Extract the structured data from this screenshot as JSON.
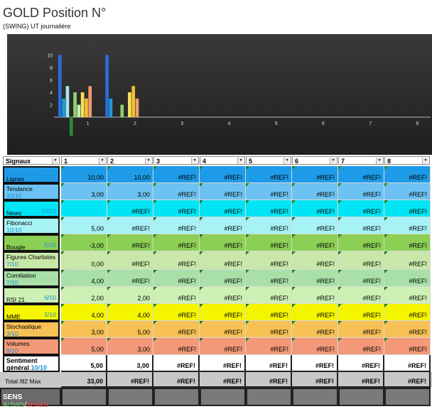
{
  "title": "GOLD Position N°",
  "subtitle": "(SWING) UT journalière",
  "chart_data": {
    "type": "bar",
    "categories": [
      "1",
      "2",
      "3",
      "4",
      "5",
      "6",
      "7",
      "8"
    ],
    "yticks": [
      "10",
      "8",
      "6",
      "4",
      "2"
    ],
    "ylim": [
      -3,
      12
    ],
    "series": [
      {
        "color": "#2a6fd8",
        "values": [
          10,
          10,
          null,
          null,
          null,
          null,
          null,
          null
        ]
      },
      {
        "color": "#1e9bd7",
        "values": [
          3,
          3,
          null,
          null,
          null,
          null,
          null,
          null
        ]
      },
      {
        "color": "#a8e6f0",
        "values": [
          5,
          null,
          null,
          null,
          null,
          null,
          null,
          null
        ]
      },
      {
        "color": "#2e8b2e",
        "values": [
          -3,
          null,
          null,
          null,
          null,
          null,
          null,
          null
        ]
      },
      {
        "color": "#8fd16a",
        "values": [
          4,
          2,
          null,
          null,
          null,
          null,
          null,
          null
        ]
      },
      {
        "color": "#c9ecb8",
        "values": [
          2,
          null,
          null,
          null,
          null,
          null,
          null,
          null
        ]
      },
      {
        "color": "#f7e25a",
        "values": [
          4,
          4,
          null,
          null,
          null,
          null,
          null,
          null
        ]
      },
      {
        "color": "#f5c030",
        "values": [
          3,
          5,
          null,
          null,
          null,
          null,
          null,
          null
        ]
      },
      {
        "color": "#f39a70",
        "values": [
          5,
          3,
          null,
          null,
          null,
          null,
          null,
          null
        ]
      }
    ]
  },
  "header": {
    "signals": "Signaux",
    "cols": [
      "1",
      "2",
      "3",
      "4",
      "5",
      "6",
      "7",
      "8"
    ]
  },
  "rows": [
    {
      "name": "Lignes",
      "score": "10/10",
      "score_pos": "right",
      "bg": "#1e9be8",
      "values": [
        "10,00",
        "10,00",
        "#REF!",
        "#REF!",
        "#REF!",
        "#REF!",
        "#REF!",
        "#REF!"
      ]
    },
    {
      "name": "Tendance",
      "score": "10/10",
      "score_pos": "below",
      "bg": "#6cc2f2",
      "values": [
        "3,00",
        "3,00",
        "#REF!",
        "#REF!",
        "#REF!",
        "#REF!",
        "#REF!",
        "#REF!"
      ]
    },
    {
      "name": "News",
      "score": "10/10",
      "score_pos": "right",
      "bg": "#00e5f5",
      "values": [
        "",
        "#REF!",
        "#REF!",
        "#REF!",
        "#REF!",
        "#REF!",
        "#REF!",
        "#REF!"
      ]
    },
    {
      "name": "Fibonacci",
      "score": "10/10",
      "score_pos": "below",
      "bg": "#a6f2f5",
      "values": [
        "5,00",
        "#REF!",
        "#REF!",
        "#REF!",
        "#REF!",
        "#REF!",
        "#REF!",
        "#REF!"
      ]
    },
    {
      "name": "Bougie",
      "score": "5/10",
      "score_pos": "right",
      "bg": "#8ccf55",
      "values": [
        "-3,00",
        "#REF!",
        "#REF!",
        "#REF!",
        "#REF!",
        "#REF!",
        "#REF!",
        "#REF!"
      ]
    },
    {
      "name": "Figures Chartistes",
      "score": "7/10",
      "score_pos": "below",
      "bg": "#c8e7a8",
      "values": [
        "0,00",
        "#REF!",
        "#REF!",
        "#REF!",
        "#REF!",
        "#REF!",
        "#REF!",
        "#REF!"
      ]
    },
    {
      "name": "Corrélation",
      "score": "7/10",
      "score_pos": "below",
      "bg": "#a8e0a8",
      "values": [
        "4,00",
        "#REF!",
        "#REF!",
        "#REF!",
        "#REF!",
        "#REF!",
        "#REF!",
        "#REF!"
      ]
    },
    {
      "name": "RSI 21",
      "score": "6/10",
      "score_pos": "right",
      "bg": "#cdf0b4",
      "values": [
        "2,00",
        "2,00",
        "#REF!",
        "#REF!",
        "#REF!",
        "#REF!",
        "#REF!",
        "#REF!"
      ]
    },
    {
      "name": "MME",
      "score": "5/10",
      "score_pos": "right",
      "bg": "#f5f500",
      "values": [
        "4,00",
        "4,00",
        "#REF!",
        "#REF!",
        "#REF!",
        "#REF!",
        "#REF!",
        "#REF!"
      ]
    },
    {
      "name": "Stochastique",
      "score": "3/10",
      "score_pos": "below",
      "bg": "#f8c155",
      "values": [
        "3,00",
        "5,00",
        "#REF!",
        "#REF!",
        "#REF!",
        "#REF!",
        "#REF!",
        "#REF!"
      ]
    },
    {
      "name": "Volumes",
      "score": "8/10",
      "score_pos": "below",
      "bg": "#f39878",
      "values": [
        "5,00",
        "3,00",
        "#REF!",
        "#REF!",
        "#REF!",
        "#REF!",
        "#REF!",
        "#REF!"
      ]
    }
  ],
  "sentiment": {
    "line1": "Sentiment",
    "line2": "général",
    "score": "10/10",
    "values": [
      "5,00",
      "3,00",
      "#REF!",
      "#REF!",
      "#REF!",
      "#REF!",
      "#REF!",
      "#REF!"
    ]
  },
  "total": {
    "label": "Total",
    "max": "/82 Max",
    "values": [
      "33,00",
      "#REF!",
      "#REF!",
      "#REF!",
      "#REF!",
      "#REF!",
      "#REF!",
      "#REF!"
    ]
  },
  "sens": {
    "label": "SENS",
    "achats": "Achats",
    "sep": "/",
    "ventes": "Ventes",
    "achats_color": "#7cd67c",
    "ventes_color": "#ff4040"
  }
}
